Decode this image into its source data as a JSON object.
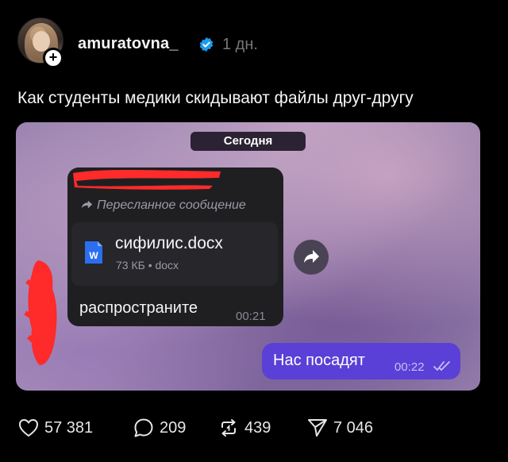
{
  "post": {
    "username": "amuratovna_",
    "time": "1 дн.",
    "follow_symbol": "+",
    "caption": "Как студенты медики скидывают файлы друг-другу"
  },
  "chat": {
    "date_label": "Сегодня",
    "forwarded_label": "Пересланное сообщение",
    "file": {
      "name": "сифилис.docx",
      "meta": "73 КБ • docx",
      "icon": "W"
    },
    "incoming_text": "распространите",
    "incoming_time": "00:21",
    "outgoing_text": "Нас посадят",
    "outgoing_time": "00:22"
  },
  "actions": {
    "likes": "57 381",
    "comments": "209",
    "reposts": "439",
    "shares": "7 046"
  },
  "colors": {
    "outgoing_bubble": "#5a40d6",
    "incoming_bubble": "#1f1f22",
    "verified": "#1d9bf0",
    "redaction": "#ff2a2a"
  }
}
